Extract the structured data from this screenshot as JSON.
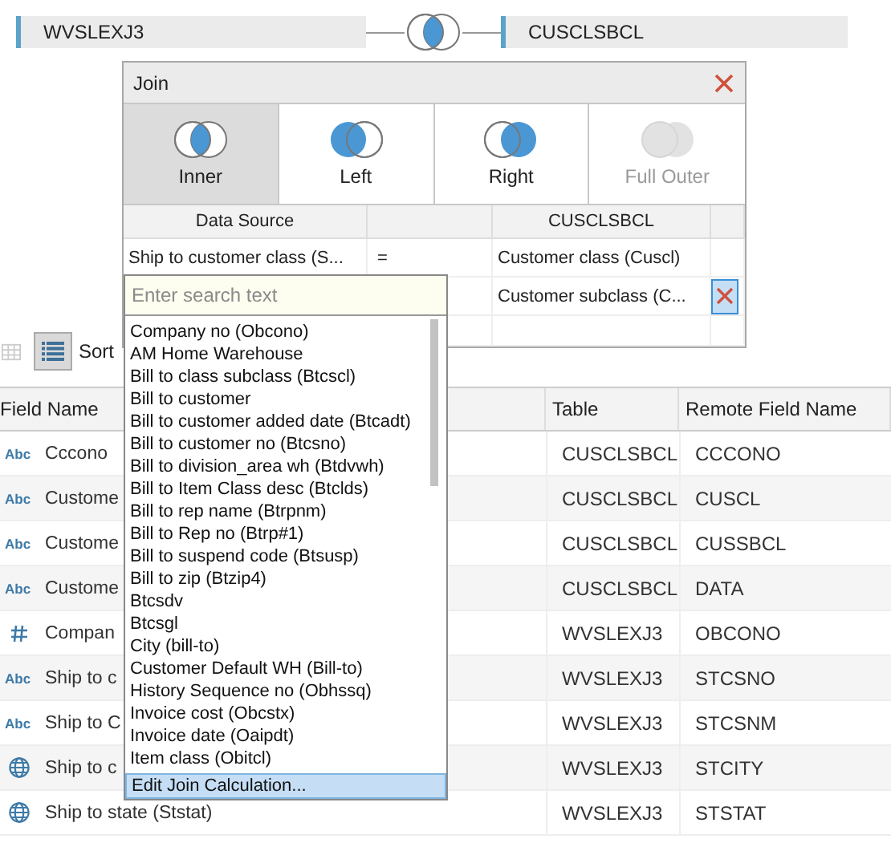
{
  "tables": {
    "left": "WVSLEXJ3",
    "right": "CUSCLSBCL"
  },
  "join_dialog": {
    "title": "Join",
    "join_types": [
      {
        "kind": "inner",
        "label": "Inner",
        "selected": true,
        "disabled": false
      },
      {
        "kind": "left",
        "label": "Left",
        "selected": false,
        "disabled": false
      },
      {
        "kind": "right",
        "label": "Right",
        "selected": false,
        "disabled": false
      },
      {
        "kind": "full",
        "label": "Full Outer",
        "selected": false,
        "disabled": true
      }
    ],
    "left_header": "Data Source",
    "right_header": "CUSCLSBCL",
    "clauses": [
      {
        "left": "Ship to customer class (S...",
        "operator": "=",
        "right": "Customer class (Cuscl)"
      },
      {
        "right": "Customer subclass (C..."
      }
    ]
  },
  "field_picker": {
    "placeholder": "Enter search text",
    "items": [
      "Company no (Obcono)",
      "AM Home Warehouse",
      "Bill to class subclass (Btcscl)",
      "Bill to customer",
      "Bill to customer added date (Btcadt)",
      "Bill to customer no (Btcsno)",
      "Bill to division_area wh (Btdvwh)",
      "Bill to Item Class desc (Btclds)",
      "Bill to rep name (Btrpnm)",
      "Bill to Rep no (Btrp#1)",
      "Bill to suspend code (Btsusp)",
      "Bill to zip (Btzip4)",
      "Btcsdv",
      "Btcsgl",
      "City (bill-to)",
      "Customer Default WH (Bill-to)",
      "History Sequence no (Obhssq)",
      "Invoice cost (Obcstx)",
      "Invoice date (Oaipdt)",
      "Item class (Obitcl)"
    ],
    "action": "Edit Join Calculation..."
  },
  "toolbar": {
    "views": [
      {
        "kind": "grid",
        "selected": false
      },
      {
        "kind": "list",
        "selected": true
      }
    ],
    "sort_label": "Sort"
  },
  "fields_table": {
    "columns": [
      "Field Name",
      "Table",
      "Remote Field Name"
    ],
    "rows": [
      {
        "kind": "string",
        "type_label": "Abc",
        "field_name": "Cccono",
        "table": "CUSCLSBCL",
        "remote_field_name": "CCCONO"
      },
      {
        "kind": "string",
        "type_label": "Abc",
        "field_name": "Custome",
        "table": "CUSCLSBCL",
        "remote_field_name": "CUSCL"
      },
      {
        "kind": "string",
        "type_label": "Abc",
        "field_name": "Custome",
        "table": "CUSCLSBCL",
        "remote_field_name": "CUSSBCL"
      },
      {
        "kind": "string",
        "type_label": "Abc",
        "field_name": "Custome",
        "table": "CUSCLSBCL",
        "remote_field_name": "DATA"
      },
      {
        "kind": "number",
        "field_name": "Compan",
        "table": "WVSLEXJ3",
        "remote_field_name": "OBCONO"
      },
      {
        "kind": "string",
        "type_label": "Abc",
        "field_name": "Ship to c",
        "table": "WVSLEXJ3",
        "remote_field_name": "STCSNO"
      },
      {
        "kind": "string",
        "type_label": "Abc",
        "field_name": "Ship to C",
        "table": "WVSLEXJ3",
        "remote_field_name": "STCSNM"
      },
      {
        "kind": "geo",
        "field_name": "Ship to c",
        "table": "WVSLEXJ3",
        "remote_field_name": "STCITY"
      },
      {
        "kind": "geo",
        "field_name": "Ship to state (Ststat)",
        "table": "WVSLEXJ3",
        "remote_field_name": "STSTAT"
      }
    ]
  }
}
